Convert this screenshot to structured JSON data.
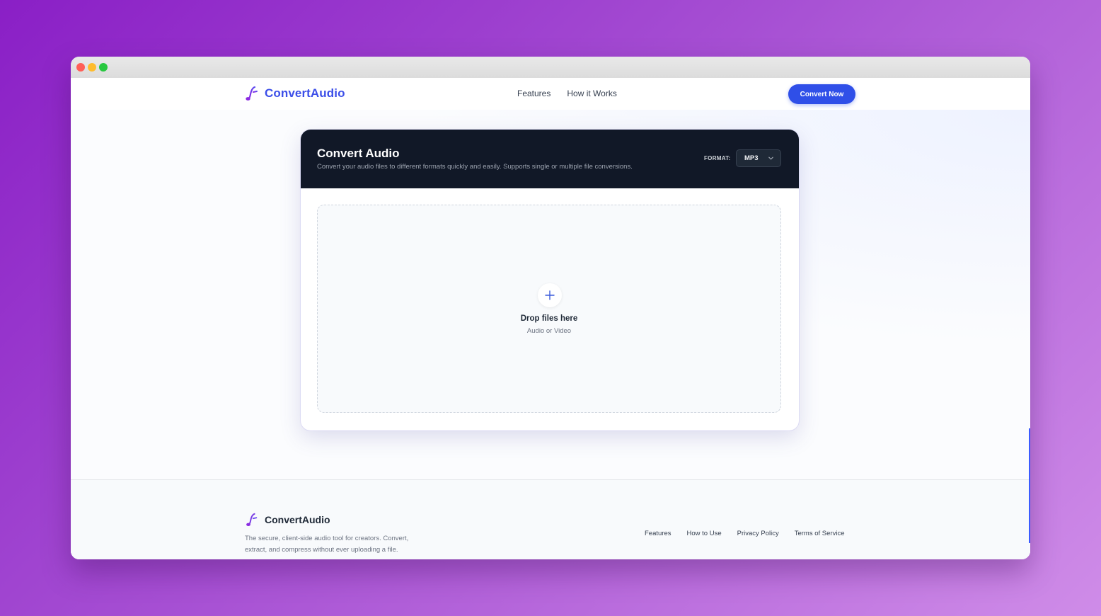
{
  "window": {
    "controls": [
      "close",
      "minimize",
      "maximize"
    ]
  },
  "brand": {
    "name": "ConvertAudio",
    "icon": "music-note-icon",
    "accent": "#3b4ee8",
    "icon_color": "#8b2be2"
  },
  "nav": {
    "links": [
      "Features",
      "How it Works"
    ],
    "cta_label": "Convert Now",
    "cta_color": "#2f4fe8"
  },
  "converter": {
    "title": "Convert Audio",
    "subtitle": "Convert your audio files to different formats quickly and easily. Supports single or multiple file conversions.",
    "format_label": "FORMAT:",
    "format_value": "MP3",
    "header_color": "#111827",
    "dropzone": {
      "icon": "plus-icon",
      "title": "Drop files here",
      "subtitle": "Audio or Video"
    }
  },
  "footer": {
    "brand": "ConvertAudio",
    "description": "The secure, client-side audio tool for creators. Convert, extract, and compress without ever uploading a file.",
    "links": [
      "Features",
      "How to Use",
      "Privacy Policy",
      "Terms of Service"
    ]
  }
}
